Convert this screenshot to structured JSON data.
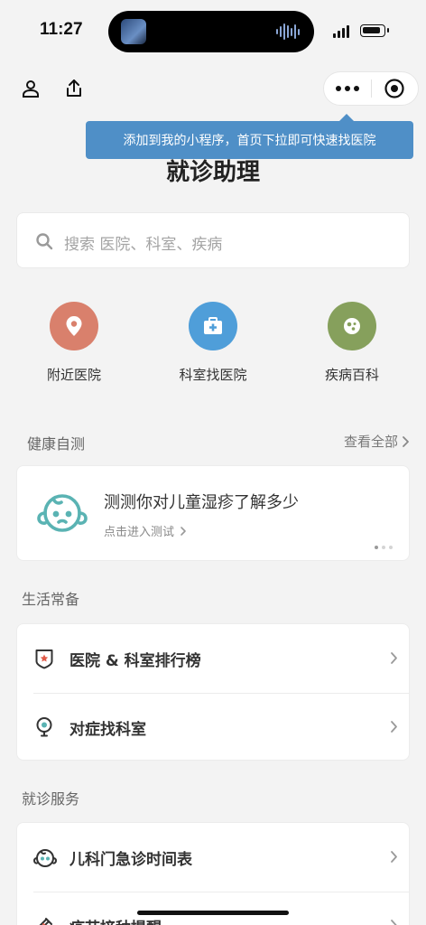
{
  "status": {
    "time": "11:27"
  },
  "tooltip": {
    "text": "添加到我的小程序，首页下拉即可快速找医院"
  },
  "header": {
    "title": "就诊助理"
  },
  "search": {
    "placeholder": "搜索 医院、科室、疾病"
  },
  "quick_actions": [
    {
      "label": "附近医院",
      "icon": "location-pin-icon",
      "color": "#d9806c"
    },
    {
      "label": "科室找医院",
      "icon": "medical-kit-icon",
      "color": "#4f9ed9"
    },
    {
      "label": "疾病百科",
      "icon": "virus-icon",
      "color": "#86a05c"
    }
  ],
  "health_test": {
    "section_title": "健康自测",
    "view_all": "查看全部",
    "card_title": "测测你对儿童湿疹了解多少",
    "card_sub": "点击进入测试",
    "icon": "baby-face-icon",
    "accent": "#5ab3b3"
  },
  "life": {
    "section_title": "生活常备",
    "items": [
      {
        "label": "医院 & 科室排行榜",
        "icon": "ranking-badge-icon"
      },
      {
        "label": "对症找科室",
        "icon": "stethoscope-icon"
      }
    ]
  },
  "service": {
    "section_title": "就诊服务",
    "items": [
      {
        "label": "儿科门急诊时间表",
        "icon": "baby-face-icon"
      },
      {
        "label": "疫苗接种提醒",
        "icon": "syringe-icon"
      }
    ]
  }
}
